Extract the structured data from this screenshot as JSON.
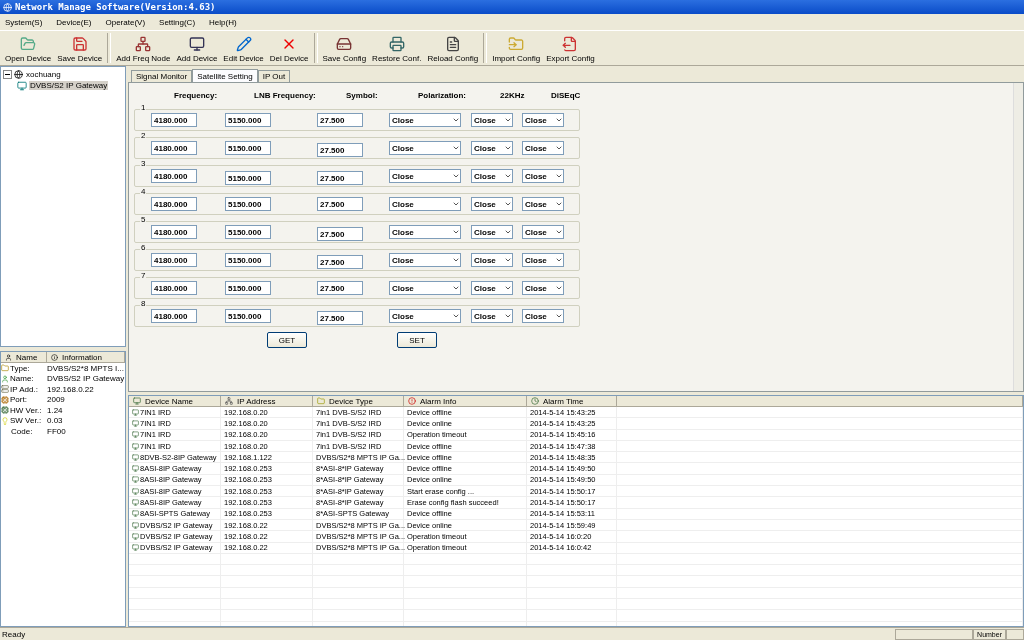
{
  "window": {
    "title": "Network Manage Software(Version:4.63)"
  },
  "menu": [
    "System(S)",
    "Device(E)",
    "Operate(V)",
    "Setting(C)",
    "Help(H)"
  ],
  "toolbar": [
    {
      "label": "Open Device",
      "kind": "open"
    },
    {
      "label": "Save Device",
      "kind": "save"
    },
    {
      "label": "Add Freq Node",
      "kind": "addnode",
      "group_start": true
    },
    {
      "label": "Add Device",
      "kind": "device"
    },
    {
      "label": "Edit Device",
      "kind": "edit"
    },
    {
      "label": "Del Device",
      "kind": "delete"
    },
    {
      "label": "Save Config",
      "kind": "saveconf",
      "group_start": true
    },
    {
      "label": "Restore Conf.",
      "kind": "restore"
    },
    {
      "label": "Reload Config",
      "kind": "reload"
    },
    {
      "label": "Import Config",
      "kind": "import",
      "group_start": true
    },
    {
      "label": "Export Config",
      "kind": "export"
    }
  ],
  "tree": [
    {
      "label": "xochuang",
      "expanded": true,
      "selected": false,
      "children": [
        {
          "label": "DVBS/S2 IP Gateway",
          "selected": true
        }
      ]
    }
  ],
  "info": {
    "columns": [
      "Name",
      "Information"
    ],
    "rows": [
      {
        "name": "Type:",
        "value": "DVBS/S2*8 MPTS I..."
      },
      {
        "name": "Name:",
        "value": "DVBS/S2 IP Gateway"
      },
      {
        "name": "IP Add.:",
        "value": "192.168.0.22"
      },
      {
        "name": "Port:",
        "value": "2009"
      },
      {
        "name": "HW Ver.:",
        "value": "1.24"
      },
      {
        "name": "SW Ver.:",
        "value": "0.03"
      },
      {
        "name": "Code:",
        "value": "FF00"
      }
    ]
  },
  "tabs": [
    {
      "label": "Signal Monitor",
      "selected": false
    },
    {
      "label": "Satellite Setting",
      "selected": true
    },
    {
      "label": "IP Out",
      "selected": false
    }
  ],
  "satellite": {
    "columns": [
      "Frequency:",
      "LNB Frequency:",
      "Symbol:",
      "Polarization:",
      "22KHz",
      "DiSEqC"
    ],
    "rows": [
      {
        "number": "1",
        "frequency": "4180.000",
        "lnb": "5150.000",
        "symbol": "27.500",
        "polarization": "Close",
        "khz22": "Close",
        "diseqc": "Close"
      },
      {
        "number": "2",
        "frequency": "4180.000",
        "lnb": "5150.000",
        "symbol": "27.500",
        "polarization": "Close",
        "khz22": "Close",
        "diseqc": "Close"
      },
      {
        "number": "3",
        "frequency": "4180.000",
        "lnb": "5150.000",
        "symbol": "27.500",
        "polarization": "Close",
        "khz22": "Close",
        "diseqc": "Close"
      },
      {
        "number": "4",
        "frequency": "4180.000",
        "lnb": "5150.000",
        "symbol": "27.500",
        "polarization": "Close",
        "khz22": "Close",
        "diseqc": "Close"
      },
      {
        "number": "5",
        "frequency": "4180.000",
        "lnb": "5150.000",
        "symbol": "27.500",
        "polarization": "Close",
        "khz22": "Close",
        "diseqc": "Close"
      },
      {
        "number": "6",
        "frequency": "4180.000",
        "lnb": "5150.000",
        "symbol": "27.500",
        "polarization": "Close",
        "khz22": "Close",
        "diseqc": "Close"
      },
      {
        "number": "7",
        "frequency": "4180.000",
        "lnb": "5150.000",
        "symbol": "27.500",
        "polarization": "Close",
        "khz22": "Close",
        "diseqc": "Close"
      },
      {
        "number": "8",
        "frequency": "4180.000",
        "lnb": "5150.000",
        "symbol": "27.500",
        "polarization": "Close",
        "khz22": "Close",
        "diseqc": "Close"
      }
    ],
    "buttons": [
      "GET",
      "SET"
    ]
  },
  "log": {
    "columns": [
      "Device Name",
      "IP Address",
      "Device Type",
      "Alarm Info",
      "Alarm Time"
    ],
    "rows": [
      [
        "7IN1 IRD",
        "192.168.0.20",
        "7in1 DVB-S/S2 IRD",
        "Device offline",
        "2014-5-14 15:43:25"
      ],
      [
        "7IN1 IRD",
        "192.168.0.20",
        "7in1 DVB-S/S2 IRD",
        "Device online",
        "2014-5-14 15:43:25"
      ],
      [
        "7IN1 IRD",
        "192.168.0.20",
        "7in1 DVB-S/S2 IRD",
        "Operation timeout",
        "2014-5-14 15:45:16"
      ],
      [
        "7IN1 IRD",
        "192.168.0.20",
        "7in1 DVB-S/S2 IRD",
        "Device offline",
        "2014-5-14 15:47:38"
      ],
      [
        "8DVB-S2-8IP Gateway",
        "192.168.1.122",
        "DVBS/S2*8 MPTS IP Ga...",
        "Device offline",
        "2014-5-14 15:48:35"
      ],
      [
        "8ASI-8IP Gateway",
        "192.168.0.253",
        "8*ASI-8*IP Gateway",
        "Device offline",
        "2014-5-14 15:49:50"
      ],
      [
        "8ASI-8IP Gateway",
        "192.168.0.253",
        "8*ASI-8*IP Gateway",
        "Device online",
        "2014-5-14 15:49:50"
      ],
      [
        "8ASI-8IP Gateway",
        "192.168.0.253",
        "8*ASI-8*IP Gateway",
        "Start erase config ...",
        "2014-5-14 15:50:17"
      ],
      [
        "8ASI-8IP Gateway",
        "192.168.0.253",
        "8*ASI-8*IP Gateway",
        "Erase config flash succeed!",
        "2014-5-14 15:50:17"
      ],
      [
        "8ASI-SPTS Gateway",
        "192.168.0.253",
        "8*ASI-SPTS Gateway",
        "Device offline",
        "2014-5-14 15:53:11"
      ],
      [
        "DVBS/S2 IP Gateway",
        "192.168.0.22",
        "DVBS/S2*8 MPTS IP Ga...",
        "Device online",
        "2014-5-14 15:59:49"
      ],
      [
        "DVBS/S2 IP Gateway",
        "192.168.0.22",
        "DVBS/S2*8 MPTS IP Ga...",
        "Operation timeout",
        "2014-5-14 16:0:20"
      ],
      [
        "DVBS/S2 IP Gateway",
        "192.168.0.22",
        "DVBS/S2*8 MPTS IP Ga...",
        "Operation timeout",
        "2014-5-14 16:0:42"
      ]
    ]
  },
  "status_bar": {
    "text": "Ready",
    "indicator": "Number"
  }
}
